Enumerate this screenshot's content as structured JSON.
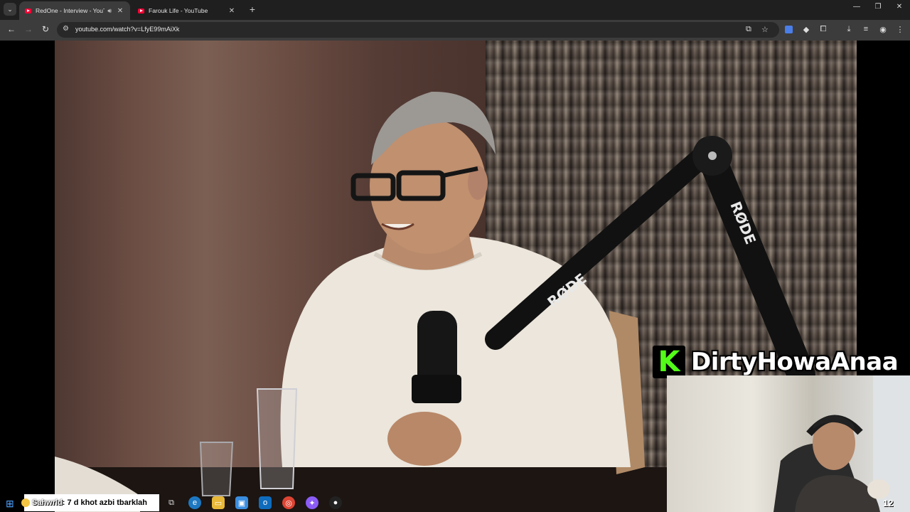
{
  "browser": {
    "tabs": [
      {
        "title": "RedOne - Interview - YouTube",
        "active": true,
        "audio": true
      },
      {
        "title": "Farouk Life - YouTube",
        "active": false,
        "audio": false
      }
    ],
    "url": "youtube.com/watch?v=LfyE99mAiXk",
    "icons": {
      "tab_search": "chevron-down-icon",
      "new_tab": "plus-icon",
      "back": "arrow-left-icon",
      "forward": "arrow-right-icon",
      "reload": "reload-icon",
      "site_info": "tune-icon",
      "cast": "cast-icon",
      "bookmark": "star-icon",
      "extension": "puzzle-icon",
      "download": "download-icon",
      "reading_list": "list-icon",
      "profile": "profile-icon",
      "menu": "kebab-icon"
    },
    "window_controls": {
      "minimize": "—",
      "restore": "❐",
      "close": "✕"
    }
  },
  "video": {
    "mic_branding": "RØDE"
  },
  "stream_overlay": {
    "platform_logo": "K",
    "channel_name": "DirtyHowaAnaa",
    "brand_color": "#53fc18",
    "chat": {
      "user": "Sahwrld",
      "message": ": 7 d khot azbi tbarklah"
    },
    "corner_badge": "12"
  },
  "taskbar": {
    "icons": [
      "task-view-icon",
      "edge-icon",
      "file-explorer-icon",
      "store-icon",
      "outlook-icon",
      "chrome-icon",
      "messenger-icon",
      "obs-icon"
    ]
  }
}
